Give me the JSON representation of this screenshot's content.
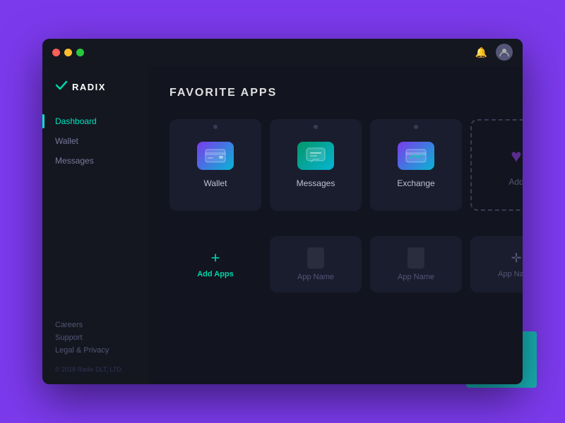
{
  "window": {
    "dots": [
      "red",
      "yellow",
      "green"
    ]
  },
  "logo": {
    "icon": "✓",
    "text": "RADIX"
  },
  "sidebar": {
    "nav_items": [
      {
        "label": "Dashboard",
        "active": true
      },
      {
        "label": "Wallet",
        "active": false
      },
      {
        "label": "Messages",
        "active": false
      }
    ],
    "footer_links": [
      {
        "label": "Careers"
      },
      {
        "label": "Support"
      },
      {
        "label": "Legal & Privacy"
      }
    ],
    "copyright": "© 2018 Radix DLT, LTD."
  },
  "content": {
    "section_title": "FAVORITE APPS",
    "fav_apps": [
      {
        "id": "wallet",
        "label": "Wallet",
        "type": "wallet"
      },
      {
        "id": "messages",
        "label": "Messages",
        "type": "messages"
      },
      {
        "id": "exchange",
        "label": "Exchange",
        "type": "exchange"
      },
      {
        "id": "add",
        "label": "Add",
        "type": "add"
      }
    ],
    "bottom_apps": [
      {
        "id": "add-apps",
        "label": "Add Apps",
        "type": "add-apps"
      },
      {
        "id": "app1",
        "label": "App Name",
        "type": "placeholder"
      },
      {
        "id": "app2",
        "label": "App Name",
        "type": "placeholder"
      },
      {
        "id": "app3",
        "label": "App Name",
        "type": "plus-placeholder"
      }
    ]
  },
  "colors": {
    "accent": "#00d4aa",
    "active_nav": "#00e5c0",
    "purple": "#7c3aed"
  }
}
